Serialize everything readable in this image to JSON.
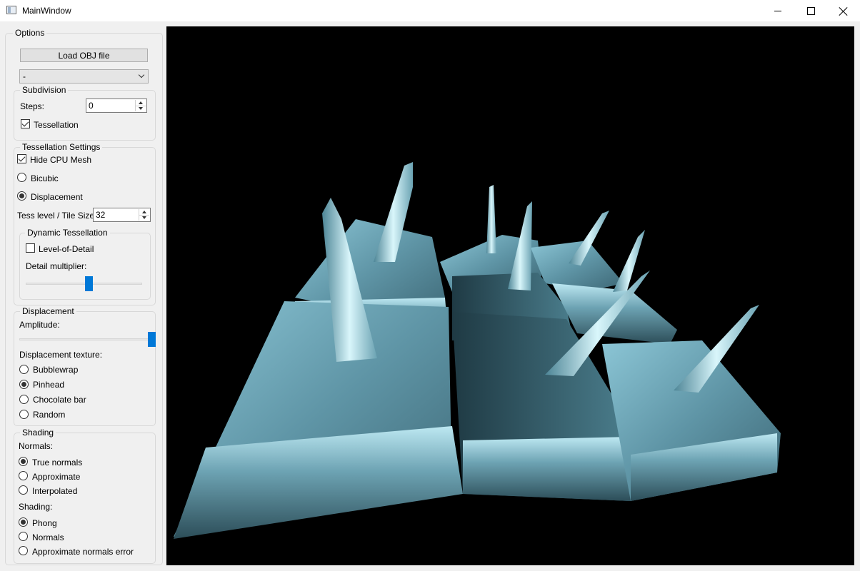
{
  "window": {
    "title": "MainWindow"
  },
  "options": {
    "title": "Options",
    "load_button": "Load OBJ file",
    "model_select": "-",
    "subdivision": {
      "title": "Subdivision",
      "steps_label": "Steps:",
      "steps_value": "0",
      "tessellation_label": "Tessellation",
      "tessellation_checked": true
    },
    "tess_settings": {
      "title": "Tessellation Settings",
      "hide_cpu_mesh": "Hide CPU Mesh",
      "bicubic": "Bicubic",
      "displacement": "Displacement",
      "tess_level_label": "Tess level / Tile Size",
      "tess_level_value": "32",
      "dynamic": {
        "title": "Dynamic Tessellation",
        "lod_label": "Level-of-Detail",
        "detail_label": "Detail multiplier:",
        "detail_level": 0.5
      }
    },
    "displacement": {
      "title": "Displacement",
      "amplitude_label": "Amplitude:",
      "amplitude_level": 1.0,
      "texture_label": "Displacement texture:",
      "textures": [
        "Bubblewrap",
        "Pinhead",
        "Chocolate bar",
        "Random"
      ],
      "selected_texture": "Pinhead"
    },
    "shading": {
      "title": "Shading",
      "normals_label": "Normals:",
      "normals": [
        "True normals",
        "Approximate",
        "Interpolated"
      ],
      "shading_label": "Shading:",
      "shading_modes": [
        "Phong",
        "Normals",
        "Approximate normals error"
      ]
    }
  },
  "colors": {
    "accent": "#0078d7",
    "viewport_bg": "#000000",
    "mesh": "#5f95a6"
  }
}
